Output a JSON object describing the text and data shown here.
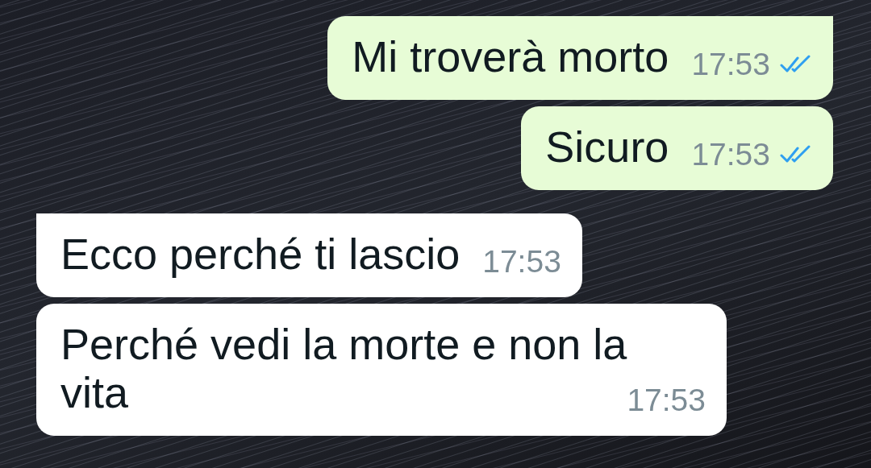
{
  "messages": [
    {
      "kind": "outgoing",
      "tail": true,
      "text": "Mi troverà morto",
      "time": "17:53",
      "read": true
    },
    {
      "kind": "outgoing",
      "tail": false,
      "text": "Sicuro",
      "time": "17:53",
      "read": true
    },
    {
      "kind": "incoming",
      "tail": true,
      "text": "Ecco perché ti lascio",
      "time": "17:53"
    },
    {
      "kind": "incoming",
      "tail": false,
      "text": "Perché vedi la morte e non la vita",
      "time": "17:53"
    }
  ]
}
